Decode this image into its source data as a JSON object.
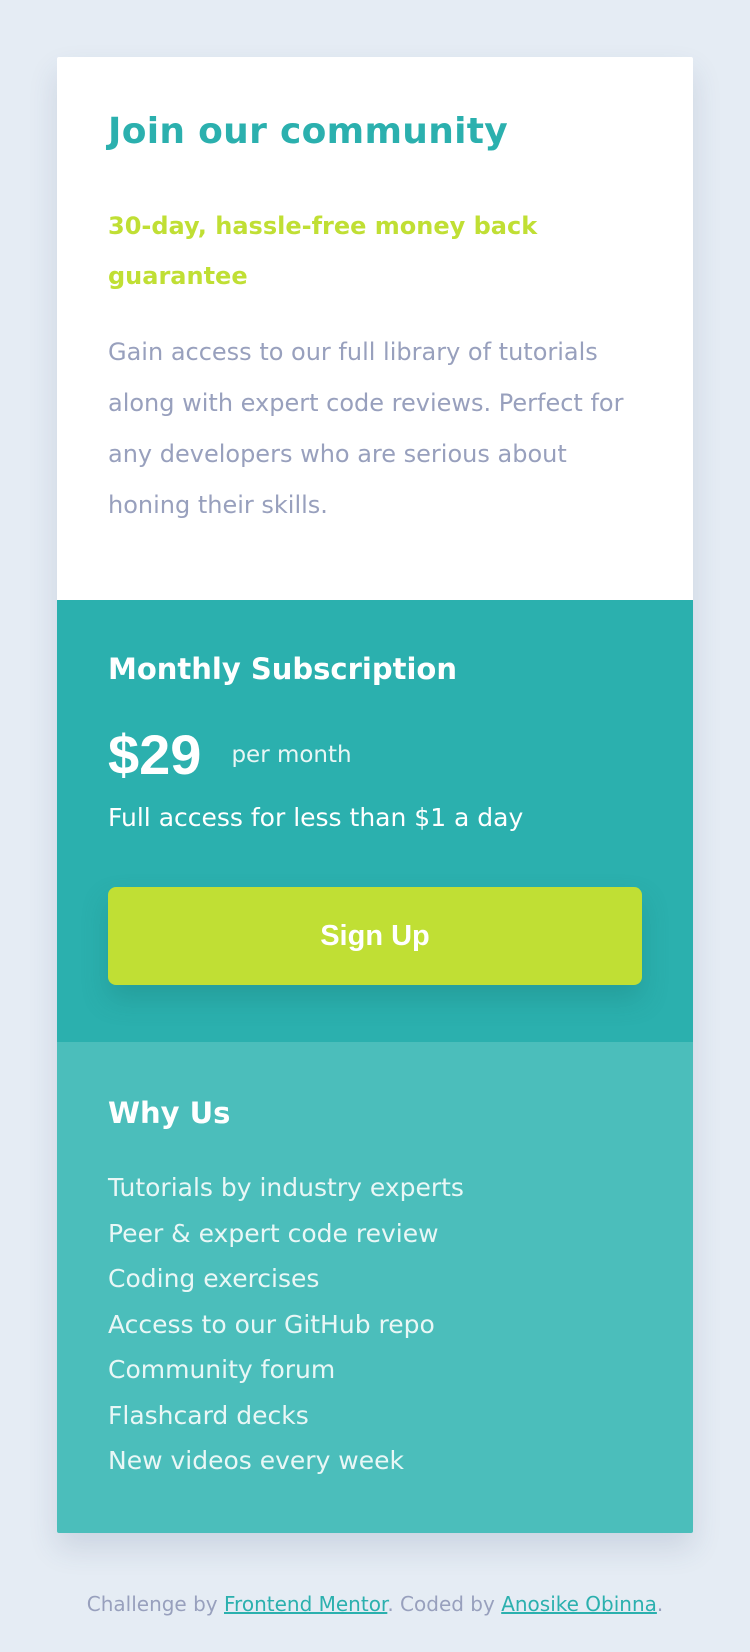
{
  "colors": {
    "background": "#e5ecf4",
    "teal": "#2bb0ae",
    "teal_light": "#4bbebb",
    "lime": "#c0df34",
    "grayish_blue": "#98a0bd",
    "white": "#ffffff"
  },
  "hero": {
    "title": "Join our community",
    "guarantee": "30-day, hassle-free money back guarantee",
    "description": "Gain access to our full library of tutorials along with expert code reviews. Perfect for any developers who are serious about honing their skills."
  },
  "subscription": {
    "heading": "Monthly Subscription",
    "price": "$29",
    "period": "per month",
    "note": "Full access for less than $1 a day",
    "cta_label": "Sign Up"
  },
  "why_us": {
    "heading": "Why Us",
    "items": [
      "Tutorials by industry experts",
      "Peer & expert code review",
      "Coding exercises",
      "Access to our GitHub repo",
      "Community forum",
      "Flashcard decks",
      "New videos every week"
    ]
  },
  "footer": {
    "prefix": "Challenge by",
    "link1": "Frontend Mentor",
    "middle": ". Coded by",
    "link2": "Anosike Obinna",
    "suffix": "."
  }
}
